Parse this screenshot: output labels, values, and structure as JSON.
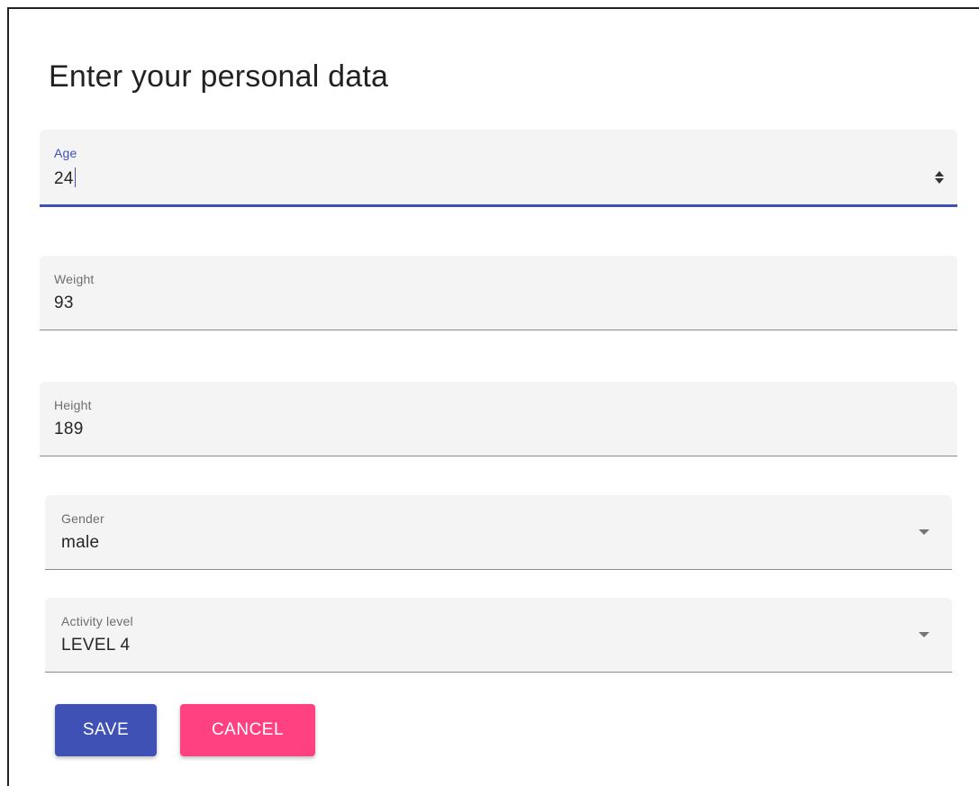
{
  "dialog": {
    "title": "Enter your personal data"
  },
  "fields": {
    "age": {
      "label": "Age",
      "value": "24",
      "focused": true
    },
    "weight": {
      "label": "Weight",
      "value": "93"
    },
    "height": {
      "label": "Height",
      "value": "189"
    },
    "gender": {
      "label": "Gender",
      "value": "male"
    },
    "activity": {
      "label": "Activity level",
      "value": "LEVEL 4"
    }
  },
  "buttons": {
    "save_label": "SAVE",
    "cancel_label": "CANCEL"
  },
  "colors": {
    "primary": "#3f51b5",
    "accent": "#ff4081",
    "field_background": "#f4f4f4"
  },
  "icons": {
    "age_spinner": "spinner-icon",
    "gender_dropdown": "chevron-down-icon",
    "activity_dropdown": "chevron-down-icon"
  }
}
